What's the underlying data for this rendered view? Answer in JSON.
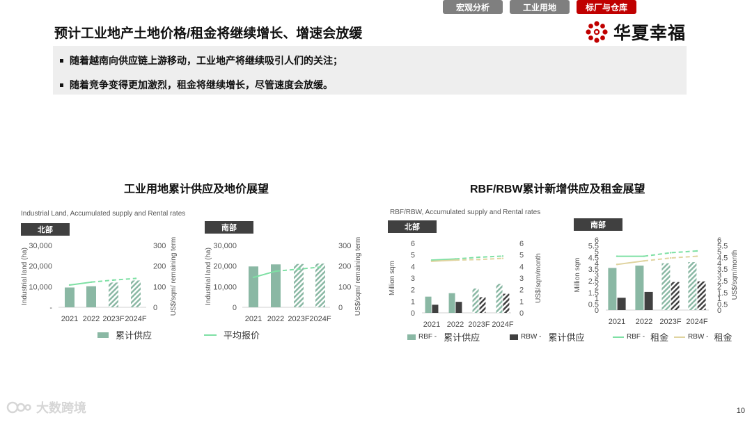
{
  "nav": {
    "tabs": [
      "宏观分析",
      "工业用地",
      "标厂与仓库"
    ],
    "active": 2
  },
  "title": "预计工业地产土地价格/租金将继续增长、增速会放缓",
  "logo": {
    "text": "华夏幸福",
    "color": "#c00000"
  },
  "bullets": [
    "随着越南向供应链上游移动，工业地产将继续吸引人们的关注；",
    "随着竞争变得更加激烈，租金将继续增长，尽管速度会放缓。"
  ],
  "left": {
    "heading": "工业用地累计供应及地价展望",
    "source": "Industrial Land, Accumulated supply and Rental rates",
    "legend": {
      "supply": "累计供应",
      "price": "平均报价"
    }
  },
  "right": {
    "heading": "RBF/RBW累计新增供应及租金展望",
    "source": "RBF/RBW, Accumulated supply and Rental rates",
    "legend": [
      {
        "prefix": "RBF -",
        "label": "累计供应"
      },
      {
        "prefix": "RBW -",
        "label": "累计供应"
      },
      {
        "prefix": "RBF -",
        "label": "租金"
      },
      {
        "prefix": "RBW -",
        "label": "租金"
      }
    ]
  },
  "colors": {
    "bar_green": "#8ab8a4",
    "bar_dark": "#404040",
    "line_green": "#7ee0a4",
    "line_tan": "#e0d4a0"
  },
  "chart_data": [
    {
      "type": "bar",
      "region": "北部",
      "categories": [
        "2021",
        "2022",
        "2023F",
        "2024F"
      ],
      "forecast_from_index": 2,
      "ylabel": "Industrial land (ha)",
      "y2label": "US$/sqm/ remaining term",
      "y_ticks": [
        "-",
        "10,000",
        "20,000",
        "30,000"
      ],
      "y_ticks_values": [
        0,
        10000,
        20000,
        30000
      ],
      "y2_ticks": [
        "0",
        "100",
        "200",
        "300"
      ],
      "ylim": [
        0,
        30000
      ],
      "y2lim": [
        0,
        300
      ],
      "series": [
        {
          "name": "累计供应",
          "kind": "bar",
          "values": [
            9600,
            10200,
            12000,
            13000
          ]
        },
        {
          "name": "平均报价",
          "kind": "line",
          "axis": "y2",
          "values": [
            108,
            122,
            132,
            140
          ]
        }
      ]
    },
    {
      "type": "bar",
      "region": "南部",
      "categories": [
        "2021",
        "2022",
        "2023F",
        "2024F"
      ],
      "forecast_from_index": 2,
      "ylabel": "Industrial land (ha)",
      "y2label": "US$/sqm/ remaining term",
      "y_ticks": [
        "0",
        "10,000",
        "20,000",
        "30,000"
      ],
      "y_ticks_values": [
        0,
        10000,
        20000,
        30000
      ],
      "y2_ticks": [
        "0",
        "100",
        "200",
        "300"
      ],
      "ylim": [
        0,
        30000
      ],
      "y2lim": [
        0,
        300
      ],
      "series": [
        {
          "name": "累计供应",
          "kind": "bar",
          "values": [
            19800,
            20800,
            21000,
            21200
          ]
        },
        {
          "name": "平均报价",
          "kind": "line",
          "axis": "y2",
          "values": [
            145,
            175,
            185,
            195
          ]
        }
      ]
    },
    {
      "type": "bar",
      "region": "北部",
      "categories": [
        "2021",
        "2022",
        "2023F",
        "2024F"
      ],
      "forecast_from_index": 2,
      "ylabel": "Million sqm",
      "y2label": "US$/sqm/month",
      "y_ticks": [
        "0",
        "1",
        "2",
        "3",
        "4",
        "5",
        "6"
      ],
      "y_ticks_values": [
        0,
        1,
        2,
        3,
        4,
        5,
        6
      ],
      "y2_ticks": [
        "0",
        "1",
        "2",
        "3",
        "4",
        "5",
        "6"
      ],
      "ylim": [
        0,
        6
      ],
      "y2lim": [
        0,
        6
      ],
      "series": [
        {
          "name": "RBF - 累计供应",
          "kind": "bar",
          "values": [
            1.4,
            1.7,
            2.1,
            2.5
          ]
        },
        {
          "name": "RBW - 累计供应",
          "kind": "bar",
          "values": [
            0.7,
            0.95,
            1.35,
            1.65
          ]
        },
        {
          "name": "RBF - 租金",
          "kind": "line",
          "axis": "y2",
          "values": [
            4.55,
            4.65,
            4.8,
            4.9
          ]
        },
        {
          "name": "RBW - 租金",
          "kind": "line",
          "axis": "y2",
          "values": [
            4.45,
            4.55,
            4.6,
            4.7
          ]
        }
      ]
    },
    {
      "type": "bar",
      "region": "南部",
      "categories": [
        "2021",
        "2022",
        "2023F",
        "2024F"
      ],
      "forecast_from_index": 2,
      "ylabel": "Million sqm",
      "y2label": "US$/sqm/month",
      "y_ticks": [
        "0",
        "0.5",
        "1",
        "1.5",
        "2",
        "2.5",
        "3",
        "3.5",
        "4",
        "4.5",
        "5",
        "5.5",
        "6"
      ],
      "y_ticks_values": [
        0,
        0.5,
        1,
        1.5,
        2,
        2.5,
        3,
        3.5,
        4,
        4.5,
        5,
        5.5,
        6
      ],
      "y2_ticks": [
        "0",
        "0.5",
        "1",
        "1.5",
        "2",
        "2.5",
        "3",
        "3.5",
        "4",
        "4.5",
        "5",
        "5.5",
        "6"
      ],
      "ylim": [
        0,
        6
      ],
      "y2lim": [
        0,
        6
      ],
      "series": [
        {
          "name": "RBF - 累计供应",
          "kind": "bar",
          "values": [
            3.6,
            3.8,
            4.0,
            4.1
          ]
        },
        {
          "name": "RBW - 累计供应",
          "kind": "bar",
          "values": [
            1.05,
            1.55,
            2.4,
            2.45
          ]
        },
        {
          "name": "RBF - 租金",
          "kind": "line",
          "axis": "y2",
          "values": [
            4.6,
            4.6,
            4.9,
            5.05
          ]
        },
        {
          "name": "RBW - 租金",
          "kind": "line",
          "axis": "y2",
          "values": [
            3.9,
            4.2,
            4.45,
            4.6
          ]
        }
      ]
    }
  ],
  "watermark": "大数跨境",
  "page_number": "10"
}
